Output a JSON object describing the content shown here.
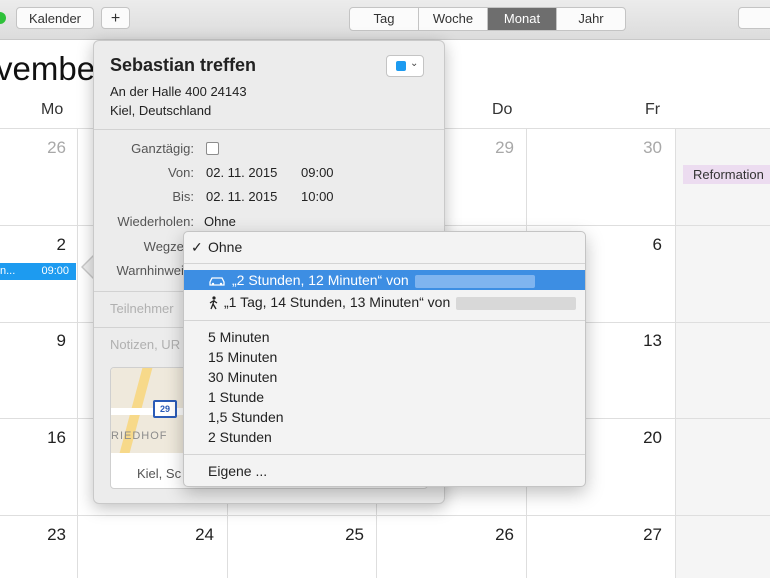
{
  "toolbar": {
    "calendars_button": "Kalender",
    "add_button": "+",
    "view_tabs": [
      "Tag",
      "Woche",
      "Monat",
      "Jahr"
    ],
    "active_view": "Monat"
  },
  "calendar": {
    "month_fragment": "vembe",
    "day_names": [
      "Mo",
      "Do",
      "Fr"
    ],
    "week1": [
      "26",
      "29",
      "30"
    ],
    "week2": [
      "2",
      "6"
    ],
    "week3": [
      "9",
      "13"
    ],
    "week4": [
      "16",
      "20"
    ],
    "week5": [
      "23",
      "24",
      "25",
      "26",
      "27"
    ],
    "holiday": "Reformation",
    "event_chip": {
      "title": "n...",
      "time": "09:00"
    }
  },
  "popover": {
    "title": "Sebastian treffen",
    "address_line1": "An der Halle 400 24143",
    "address_line2": "Kiel, Deutschland",
    "allday_label": "Ganztägig:",
    "from_label": "Von:",
    "from_date": "02. 11. 2015",
    "from_time": "09:00",
    "to_label": "Bis:",
    "to_date": "02. 11. 2015",
    "to_time": "10:00",
    "repeat_label": "Wiederholen:",
    "repeat_value": "Ohne",
    "travel_label": "Wegzeit:",
    "alert_label": "Warnhinweis:",
    "attendees_placeholder": "Teilnehmer",
    "notes_placeholder": "Notizen, UR",
    "map_shield": "29",
    "map_area": "RIEDHOF",
    "map_location": "Kiel, Sc"
  },
  "menu": {
    "none": "Ohne",
    "by_car": "„2 Stunden, 12 Minuten“ von",
    "by_foot": "„1 Tag, 14 Stunden, 13 Minuten“ von",
    "options": [
      "5 Minuten",
      "15 Minuten",
      "30 Minuten",
      "1 Stunde",
      "1,5 Stunden",
      "2 Stunden"
    ],
    "custom": "Eigene ..."
  },
  "colors": {
    "accent": "#1d9bf0",
    "selection": "#3d8ee3",
    "holiday_bg": "#ecdcf0"
  }
}
